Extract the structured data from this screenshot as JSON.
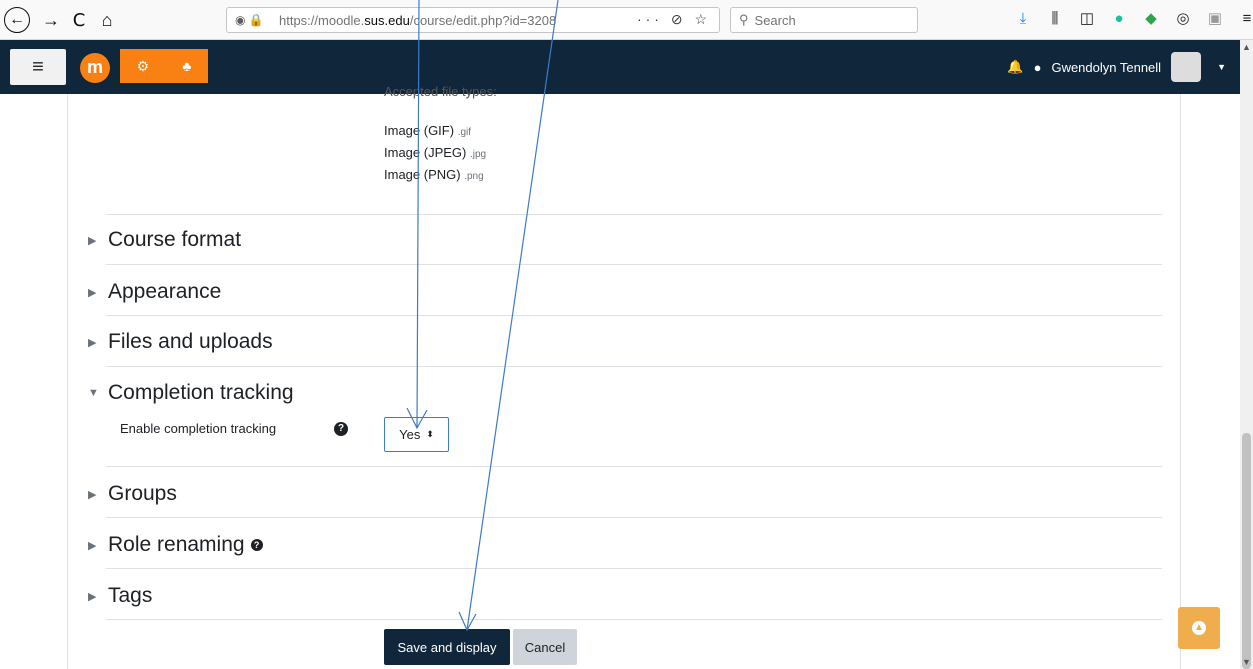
{
  "browser": {
    "back_icon": "←",
    "forward_icon": "→",
    "reload_icon": "C",
    "home_icon": "⌂",
    "url_prefix": "https://moodle.",
    "url_domain": "sus.edu",
    "url_path": "/course/edit.php?id=3208",
    "url_actions": "··· ⊘ ☆",
    "search_placeholder": "Search"
  },
  "navbar": {
    "menu_icon": "≡",
    "logo_letter": "m",
    "user_name": "Gwendolyn Tennell"
  },
  "file_types": {
    "heading": "Accepted file types:",
    "items": [
      {
        "name": "Image (GIF)",
        "ext": ".gif"
      },
      {
        "name": "Image (JPEG)",
        "ext": ".jpg"
      },
      {
        "name": "Image (PNG)",
        "ext": ".png"
      }
    ]
  },
  "sections": {
    "course_format": "Course format",
    "appearance": "Appearance",
    "files_uploads": "Files and uploads",
    "completion_tracking": "Completion tracking",
    "groups": "Groups",
    "role_renaming": "Role renaming",
    "tags": "Tags"
  },
  "completion": {
    "label": "Enable completion tracking",
    "value": "Yes"
  },
  "buttons": {
    "save": "Save and display",
    "cancel": "Cancel"
  },
  "colors": {
    "navbar": "#10263b",
    "accent": "#f98012",
    "annotation_arrow": "#3d7bc8"
  }
}
